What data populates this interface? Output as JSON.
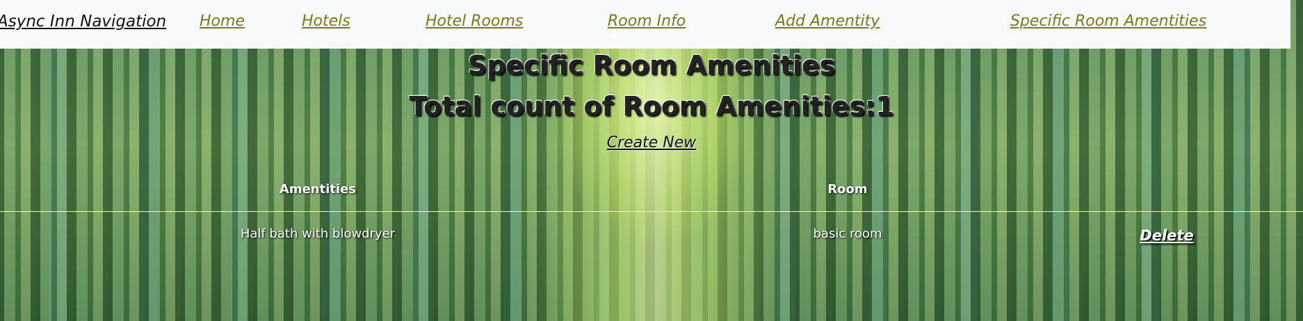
{
  "nav": {
    "brand": "Async Inn Navigation",
    "links": [
      "Home",
      "Hotels",
      "Hotel Rooms",
      "Room Info",
      "Add Amentity",
      "Specific Room Amentities"
    ]
  },
  "page": {
    "title": "Specific Room Amenities",
    "count_label": "Total count of Room Amenities:1",
    "create_new": "Create New"
  },
  "table": {
    "headers": [
      "Amentities",
      "Room"
    ],
    "rows": [
      {
        "amenity": "Half bath with blowdryer",
        "room": "basic room",
        "action": "Delete"
      }
    ]
  },
  "colors": {
    "nav_bg": "#f7f9fa",
    "nav_link": "#7a7a16",
    "brand": "#111111"
  }
}
